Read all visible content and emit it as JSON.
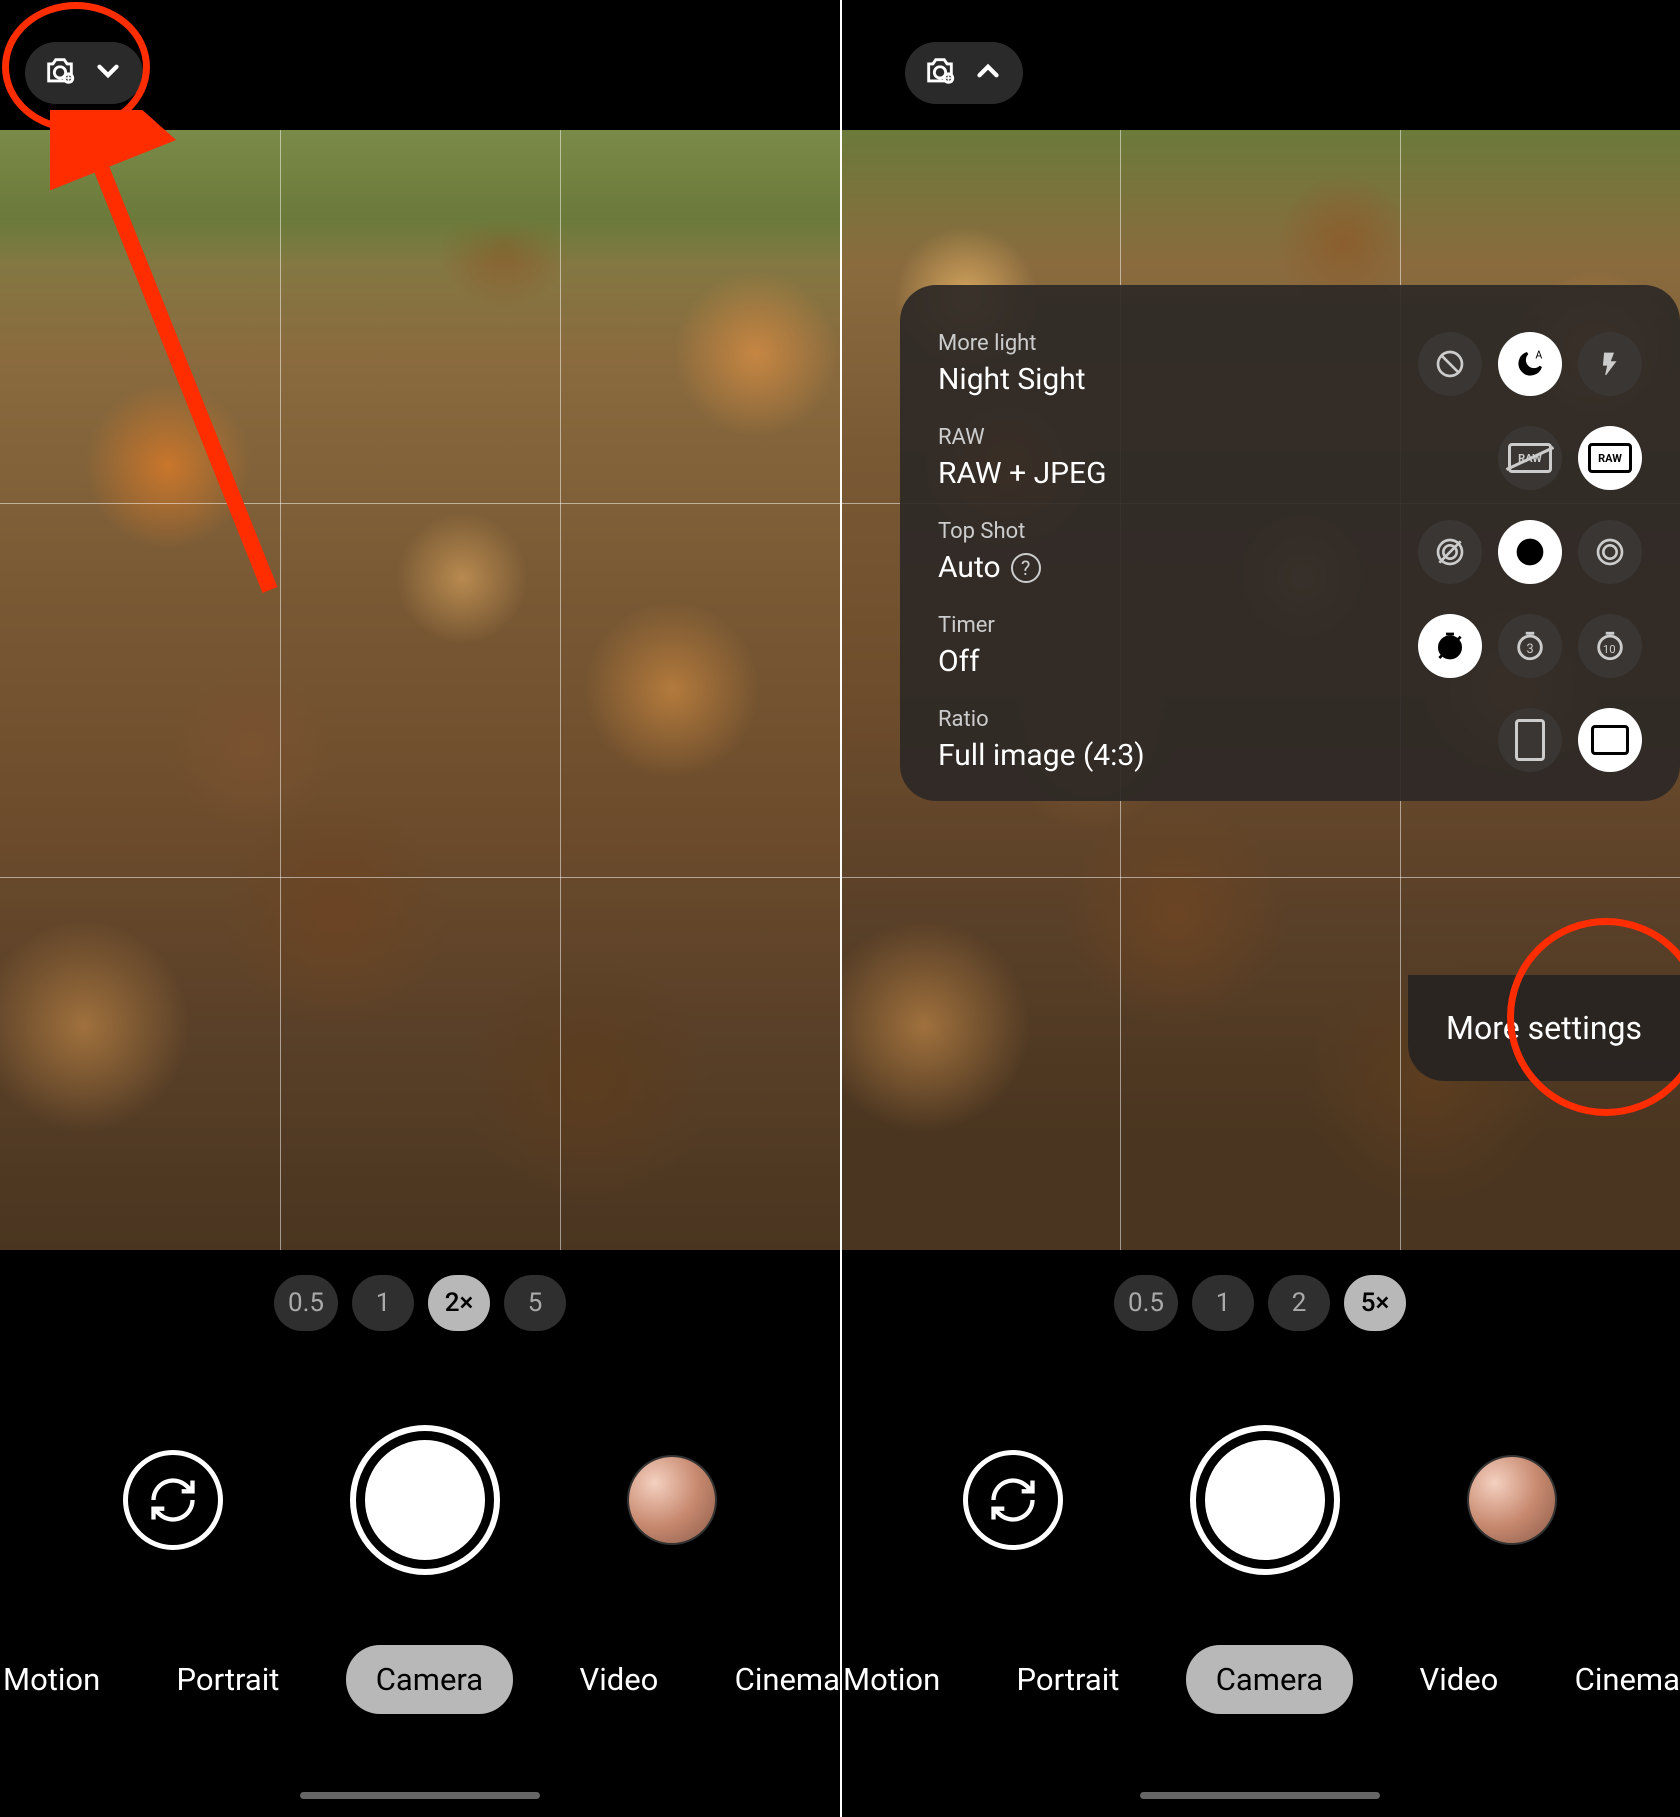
{
  "left": {
    "zoom": [
      "0.5",
      "1",
      "2×",
      "5"
    ],
    "zoom_selected_index": 2,
    "modes": [
      "Motion",
      "Portrait",
      "Camera",
      "Video",
      "Cinema"
    ],
    "mode_selected_index": 2
  },
  "right": {
    "zoom": [
      "0.5",
      "1",
      "2",
      "5×"
    ],
    "zoom_selected_index": 3,
    "modes": [
      "Motion",
      "Portrait",
      "Camera",
      "Video",
      "Cinema"
    ],
    "mode_selected_index": 2,
    "quick_settings": {
      "more_light": {
        "title": "More light",
        "value": "Night Sight",
        "options": [
          "off",
          "night-auto",
          "flash"
        ],
        "selected": 1
      },
      "raw": {
        "title": "RAW",
        "value": "RAW + JPEG",
        "options": [
          "raw-off",
          "raw-on"
        ],
        "selected": 1
      },
      "top_shot": {
        "title": "Top Shot",
        "value": "Auto",
        "options": [
          "off",
          "auto",
          "on"
        ],
        "selected": 1
      },
      "timer": {
        "title": "Timer",
        "value": "Off",
        "options": [
          "off",
          "3",
          "10"
        ],
        "selected": 0
      },
      "ratio": {
        "title": "Ratio",
        "value": "Full image (4:3)",
        "options": [
          "tall",
          "full"
        ],
        "selected": 1
      },
      "more_settings_label": "More settings"
    }
  }
}
